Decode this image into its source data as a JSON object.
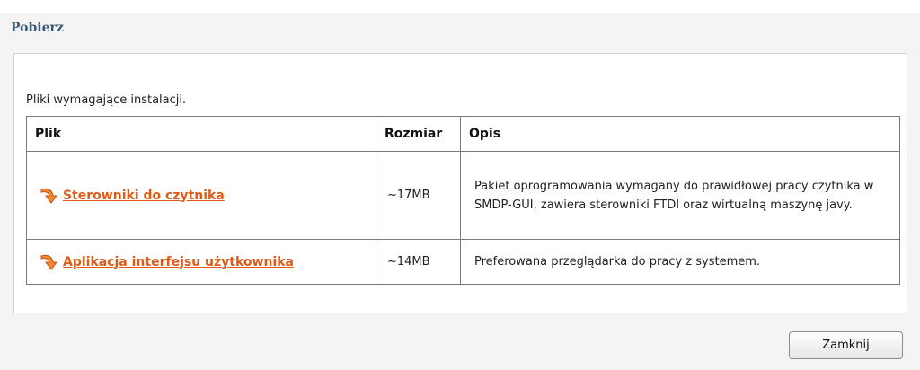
{
  "dialog": {
    "title": "Pobierz",
    "intro": "Pliki wymagające instalacji.",
    "close_label": "Zamknij"
  },
  "table": {
    "headers": [
      "Plik",
      "Rozmiar",
      "Opis"
    ],
    "rows": [
      {
        "icon": "download-arrow-icon",
        "file": "Sterowniki do czytnika",
        "size": "~17MB",
        "description": "Pakiet oprogramowania wymagany do prawidłowej pracy czytnika w SMDP-GUI, zawiera sterowniki FTDI oraz wirtualną maszynę javy."
      },
      {
        "icon": "download-arrow-icon",
        "file": "Aplikacja interfejsu użytkownika",
        "size": "~14MB",
        "description": "Preferowana przeglądarka do pracy z systemem."
      }
    ]
  },
  "colors": {
    "title": "#3c5a78",
    "link": "#e05a16",
    "panel_bg": "#f4f4f4",
    "border": "#7a7a7a"
  }
}
